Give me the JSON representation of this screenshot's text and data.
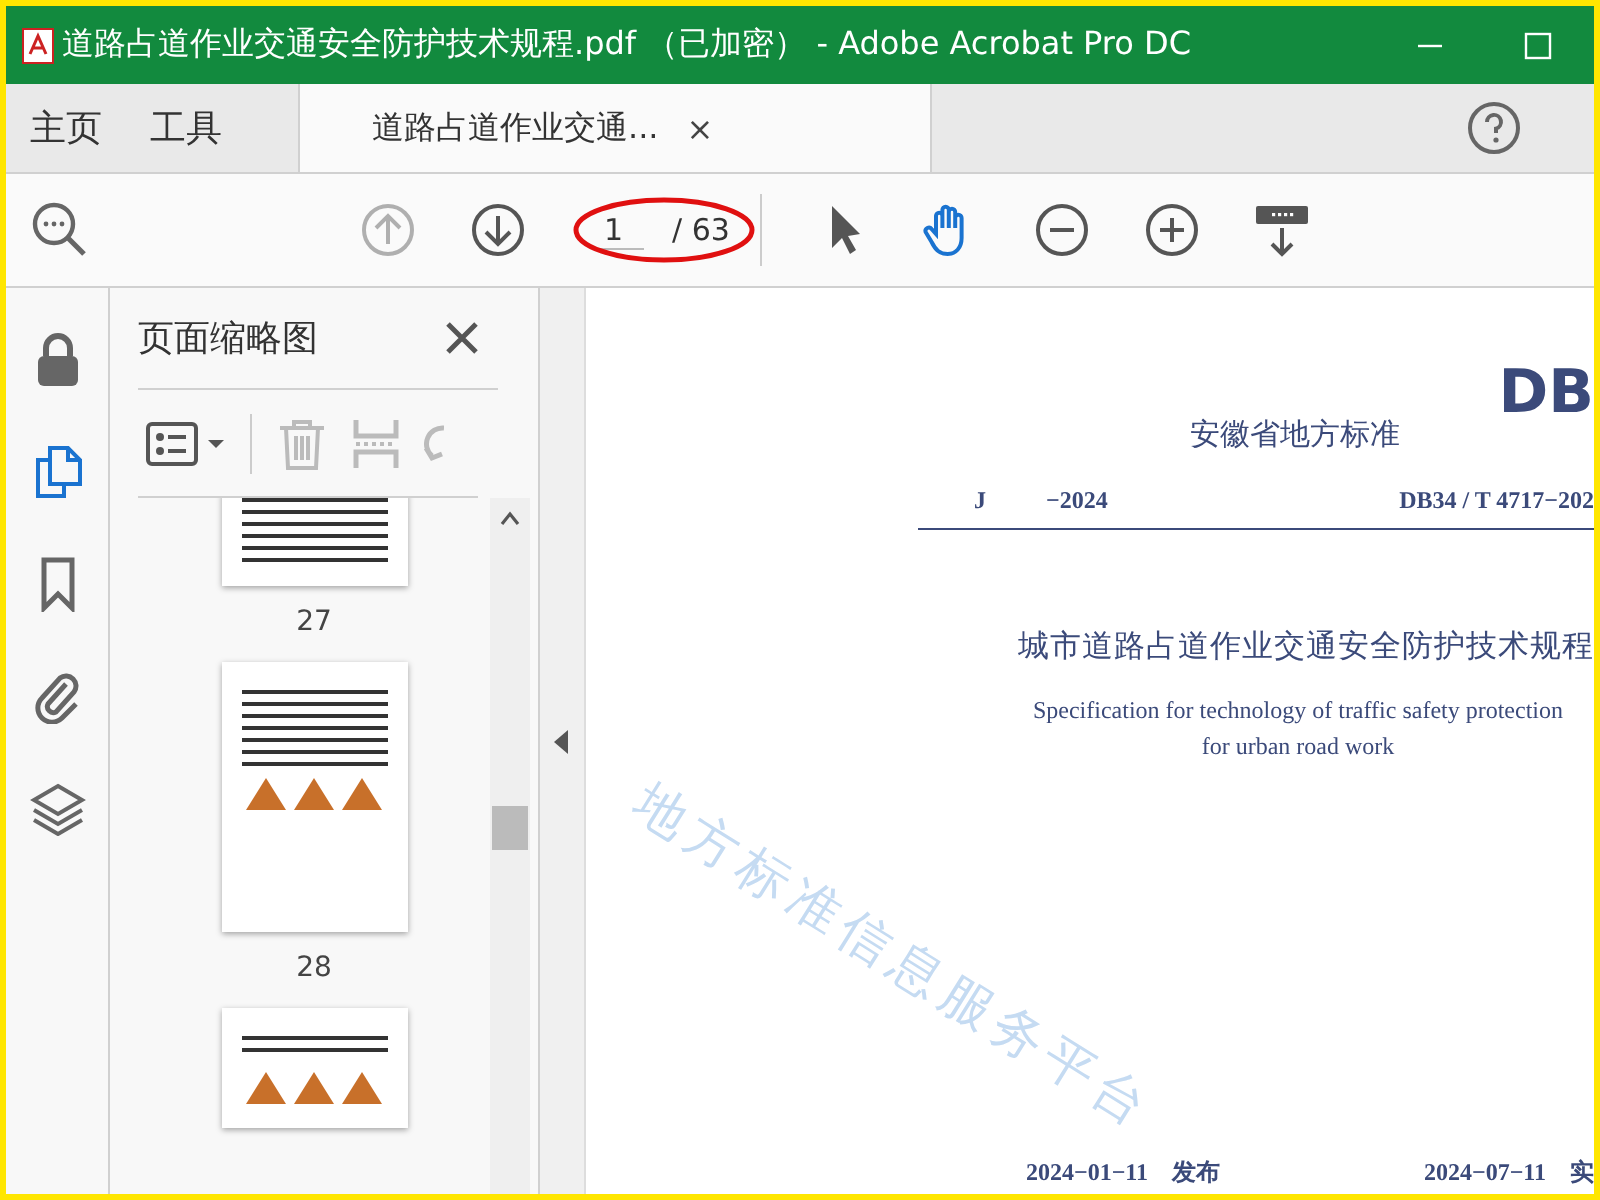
{
  "window": {
    "title": "道路占道作业交通安全防护技术规程.pdf （已加密） - Adobe Acrobat Pro DC"
  },
  "tabs": [
    {
      "label": "主页",
      "selected": false
    },
    {
      "label": "工具",
      "selected": false
    },
    {
      "label": "道路占道作业交通...",
      "selected": true,
      "close": "×"
    }
  ],
  "toolbar": {
    "page_input": "1",
    "page_total": "/ 63",
    "nav": [
      {
        "kind": "up",
        "disabled": true
      },
      {
        "kind": "down",
        "disabled": false
      }
    ],
    "tools": [
      {
        "kind": "select",
        "selected": false
      },
      {
        "kind": "hand",
        "selected": true
      },
      {
        "kind": "zoom-out",
        "selected": false
      },
      {
        "kind": "zoom-in",
        "selected": false
      },
      {
        "kind": "scroll-mode",
        "selected": false
      }
    ]
  },
  "sidebar": {
    "items": [
      {
        "kind": "lock",
        "selected": false
      },
      {
        "kind": "pages",
        "selected": true
      },
      {
        "kind": "bookmark",
        "selected": false
      },
      {
        "kind": "attachment",
        "selected": false
      },
      {
        "kind": "layers",
        "selected": false
      }
    ]
  },
  "thumbnails_panel": {
    "title": "页面缩略图",
    "pages": [
      {
        "label": "27"
      },
      {
        "label": "28"
      }
    ]
  },
  "document": {
    "code_big": "DB",
    "authority": "安徽省地方标准",
    "record_no": "J",
    "record_year": "−2024",
    "standard_no": "DB34 / T 4717−202",
    "title": "城市道路占道作业交通安全防护技术规程",
    "subtitle_lines": [
      "Specification for technology of traffic safety protection",
      "for urban road work"
    ],
    "watermark": "地方标准信息服务平台",
    "issue_date": "2024−01−11　发布",
    "effective_date": "2024−07−11　实"
  }
}
